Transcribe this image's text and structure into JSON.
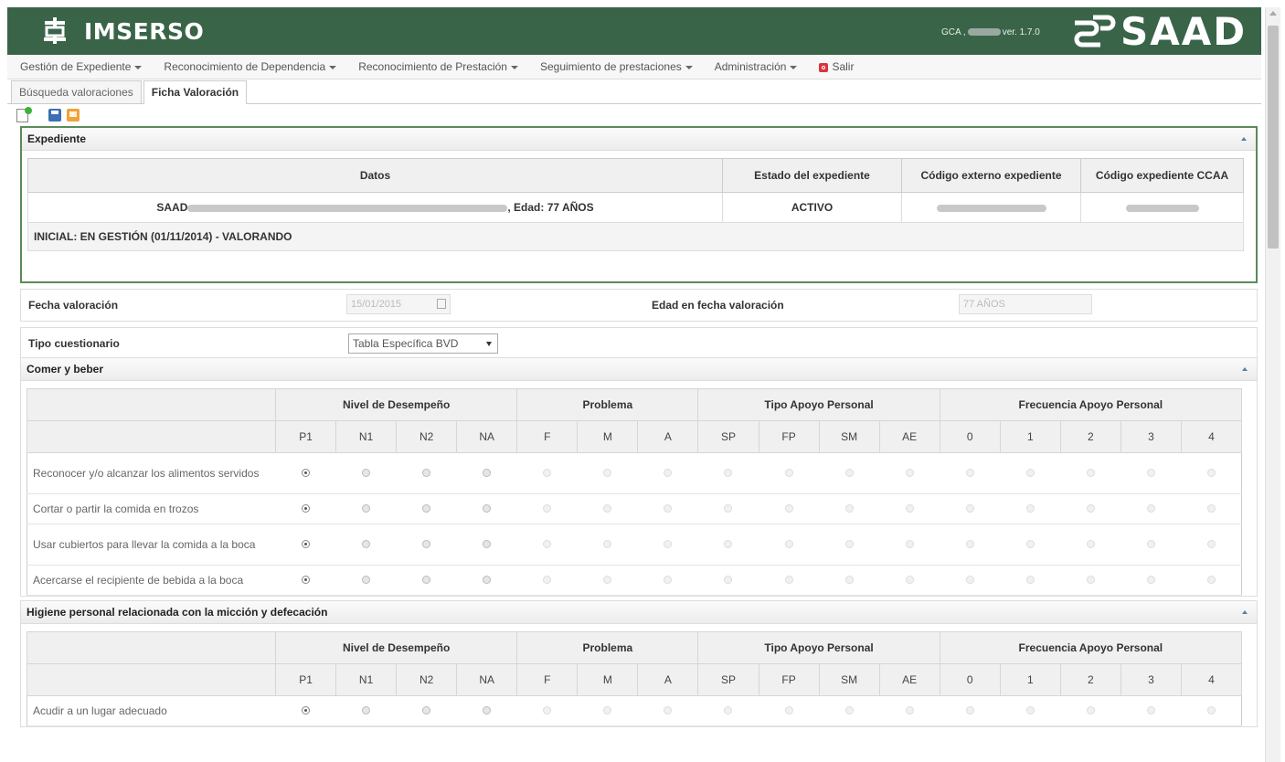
{
  "header": {
    "app_title": "IMSERSO",
    "version_prefix": "GCA ,",
    "version_suffix": "ver. 1.7.0",
    "brand": "SAAD",
    "bg_color": "#3a6448"
  },
  "menu": {
    "items": [
      {
        "label": "Gestión de Expediente",
        "dropdown": true
      },
      {
        "label": "Reconocimiento de Dependencia",
        "dropdown": true
      },
      {
        "label": "Reconocimiento de Prestación",
        "dropdown": true
      },
      {
        "label": "Seguimiento de prestaciones",
        "dropdown": true
      },
      {
        "label": "Administración",
        "dropdown": true
      }
    ],
    "exit_label": "Salir"
  },
  "tabs": [
    {
      "label": "Búsqueda valoraciones",
      "active": false
    },
    {
      "label": "Ficha Valoración",
      "active": true
    }
  ],
  "toolbar": {
    "icons": [
      "new-document-icon",
      "save-icon",
      "print-icon"
    ]
  },
  "expediente": {
    "title": "Expediente",
    "columns": [
      "Datos",
      "Estado del expediente",
      "Código externo expediente",
      "Código expediente CCAA"
    ],
    "datos_prefix": "SAAD",
    "datos_suffix": ", Edad: 77 AÑOS",
    "estado": "ACTIVO",
    "inicial": "INICIAL: EN GESTIÓN (01/11/2014) - VALORANDO"
  },
  "valoracion": {
    "fecha_label": "Fecha valoración",
    "fecha_value": "15/01/2015",
    "edad_label": "Edad en fecha valoración",
    "edad_value": "77 AÑOS",
    "tipo_label": "Tipo cuestionario",
    "tipo_value": "Tabla Específica BVD"
  },
  "groups": [
    "Nivel de Desempeño",
    "Problema",
    "Tipo Apoyo Personal",
    "Frecuencia Apoyo Personal"
  ],
  "sub_columns": [
    "P1",
    "N1",
    "N2",
    "NA",
    "F",
    "M",
    "A",
    "SP",
    "FP",
    "SM",
    "AE",
    "0",
    "1",
    "2",
    "3",
    "4"
  ],
  "sections": [
    {
      "title": "Comer y beber",
      "rows": [
        {
          "label": "Reconocer y/o alcanzar los alimentos servidos",
          "selected": "P1"
        },
        {
          "label": "Cortar o partir la comida en trozos",
          "selected": "P1"
        },
        {
          "label": "Usar cubiertos para llevar la comida a la boca",
          "selected": "P1"
        },
        {
          "label": "Acercarse el recipiente de bebida a la boca",
          "selected": "P1"
        }
      ]
    },
    {
      "title": "Higiene personal relacionada con la micción y defecación",
      "rows": [
        {
          "label": "Acudir a un lugar adecuado",
          "selected": "P1"
        }
      ]
    }
  ]
}
